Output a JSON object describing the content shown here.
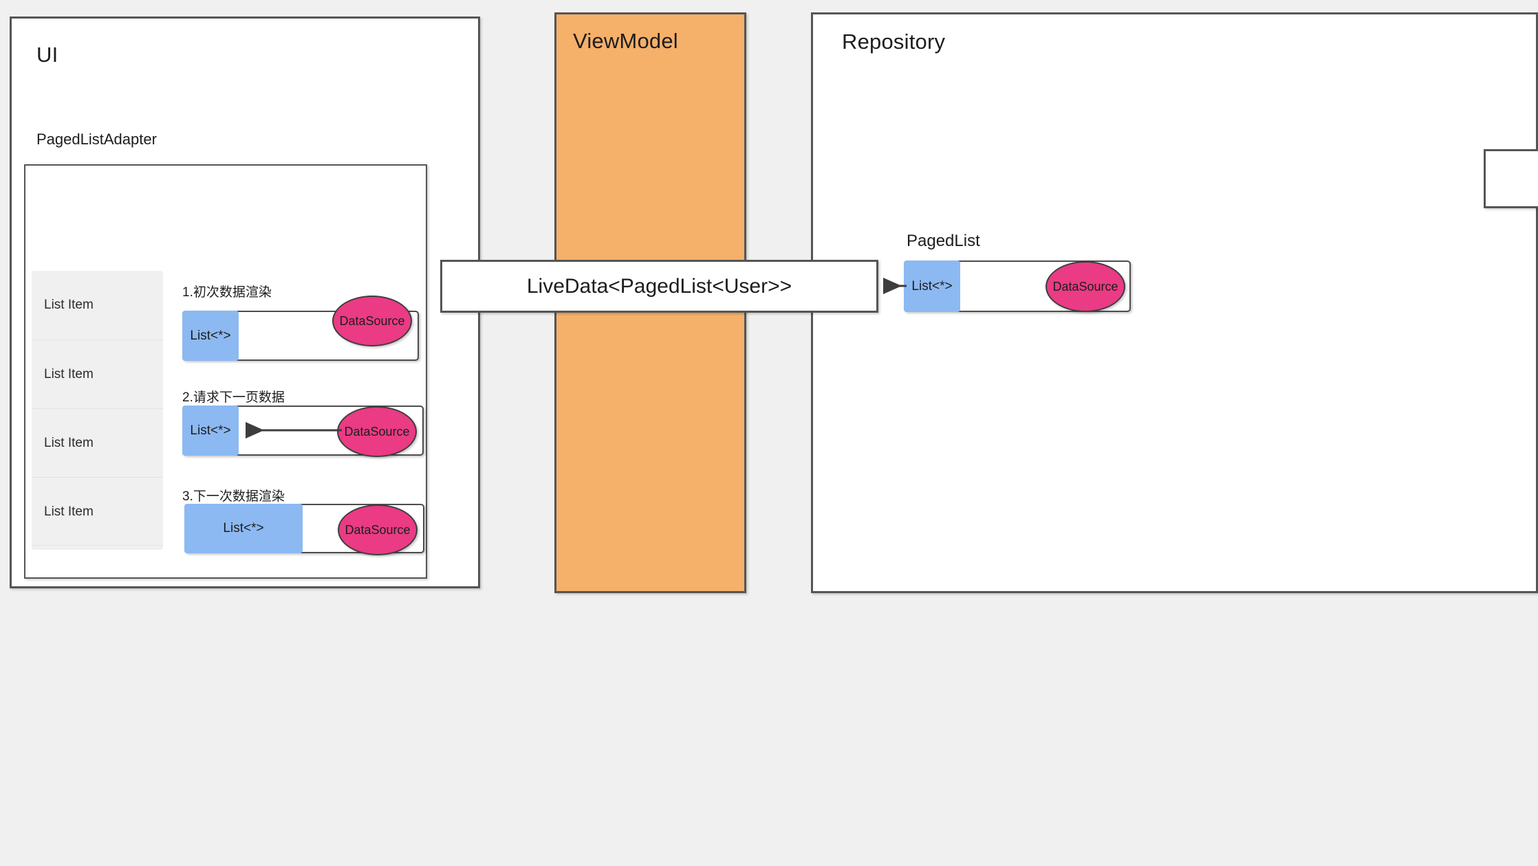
{
  "diagram": {
    "title_ui": "UI",
    "title_viewmodel": "ViewModel",
    "title_repository": "Repository",
    "subtitle_pagedlistadapter": "PagedListAdapter",
    "label_pagedlist": "PagedList",
    "livedata_label": "LiveData<PagedList<User>>"
  },
  "colors": {
    "background": "#f0f0f0",
    "panel": "#ffffff",
    "border": "#555555",
    "viewmodel_fill": "#f5b06a",
    "list_chunk_fill": "#8cb9f2",
    "datasource_fill": "#ea3b84",
    "list_box_fill": "#f0f0f0",
    "text": "#1d1d1d"
  },
  "list": {
    "items": [
      {
        "label": "List Item"
      },
      {
        "label": "List Item"
      },
      {
        "label": "List Item"
      },
      {
        "label": "List Item"
      }
    ]
  },
  "steps": [
    {
      "label": "1.初次数据渲染",
      "list_label": "List<*>",
      "datasource_label": "DataSource",
      "has_arrow": false
    },
    {
      "label": "2.请求下一页数据",
      "list_label": "List<*>",
      "datasource_label": "DataSource",
      "has_arrow": true
    },
    {
      "label": "3.下一次数据渲染",
      "list_label": "List<*>",
      "datasource_label": "DataSource",
      "has_arrow": false
    }
  ],
  "repository_pagedlist": {
    "list_label": "List<*>",
    "datasource_label": "DataSource"
  }
}
